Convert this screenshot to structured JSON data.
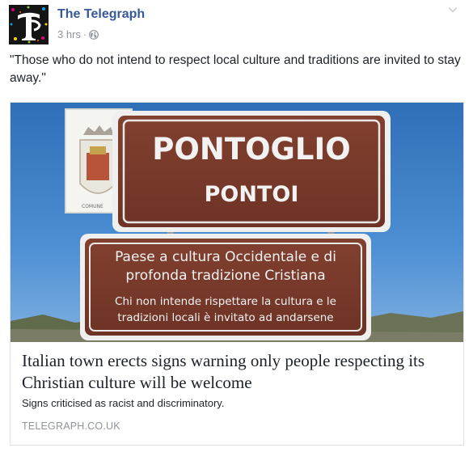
{
  "post": {
    "page_name": "The Telegraph",
    "timestamp": "3 hrs",
    "separator": "·",
    "privacy_icon": "globe-icon",
    "menu_icon": "chevron-down-icon",
    "avatar_icon": "telegraph-logo-icon",
    "text": "\"Those who do not intend to respect local culture and traditions are invited to stay away.\""
  },
  "link": {
    "image": {
      "sign_main_line1": "PONTOGLIO",
      "sign_main_line2": "PONTOI",
      "sign_sub_line1": "Paese a cultura Occidentale e di",
      "sign_sub_line2": "profonda tradizione Cristiana",
      "sign_sub_line3": "Chi non intende rispettare la cultura e le",
      "sign_sub_line4": "tradizioni locali è invitato ad andarsene"
    },
    "title": "Italian town erects signs warning only people respecting its Christian culture will be welcome",
    "description": "Signs criticised as racist and discriminatory.",
    "domain": "TELEGRAPH.CO.UK"
  },
  "colors": {
    "page_name": "#365899",
    "meta": "#90949c",
    "sign_brown": "#7a3a2c",
    "sky": "#3f82c9"
  }
}
